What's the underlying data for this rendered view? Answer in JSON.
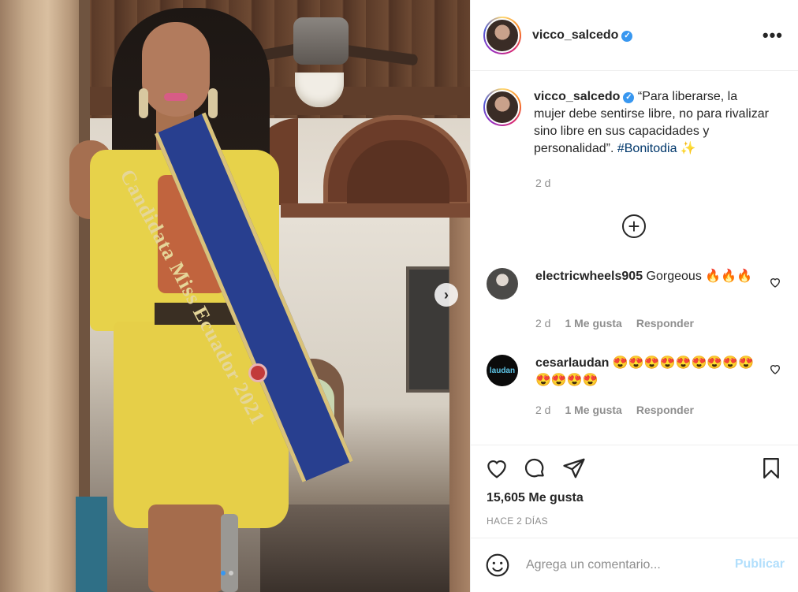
{
  "post": {
    "username": "vicco_salcedo",
    "verified_badge": "✓",
    "more_label": "•••",
    "caption_text": "“Para liberarse, la mujer debe sentirse libre, no para rivalizar sino libre en sus capacidades y personalidad”. ",
    "caption_hashtag": "#Bonitodia",
    "caption_emoji": "✨",
    "caption_time": "2 d",
    "load_more_label": "+",
    "sash_text": "Candidata Miss Ecuador 2021",
    "next_label": "›"
  },
  "comments": [
    {
      "username": "electricwheels905",
      "text": "Gorgeous 🔥🔥🔥",
      "time": "2 d",
      "likes": "1 Me gusta",
      "reply": "Responder"
    },
    {
      "username": "cesarlaudan",
      "text": "😍😍😍😍😍😍😍😍😍😍😍😍😍",
      "time": "2 d",
      "likes": "1 Me gusta",
      "reply": "Responder",
      "avatar_text": "laudan"
    }
  ],
  "footer": {
    "likes_count": "15,605 Me gusta",
    "posted_ago": "HACE 2 DÍAS",
    "comment_placeholder": "Agrega un comentario...",
    "publish_label": "Publicar"
  },
  "icons": {
    "heart": "heart-icon",
    "comment": "comment-icon",
    "share": "paper-plane-icon",
    "save": "bookmark-icon",
    "emoji": "smiley-icon",
    "more": "more-dots-icon",
    "next": "chevron-right-icon"
  },
  "colors": {
    "accent": "#3897f0",
    "hashtag": "#00376b",
    "muted": "#8e8e8e",
    "publish_disabled": "#b2dffc"
  },
  "carousel": {
    "slides": 2,
    "active": 0
  }
}
